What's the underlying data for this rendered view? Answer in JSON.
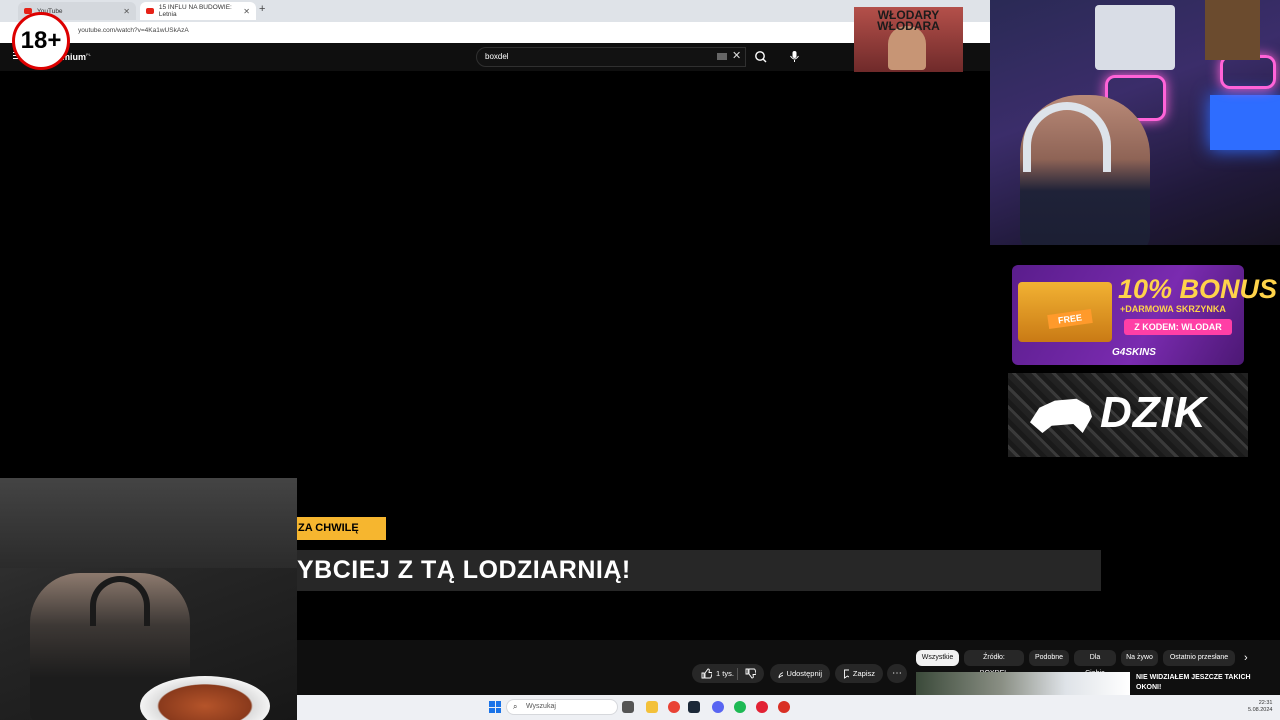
{
  "browser": {
    "tabs": [
      {
        "label": "YouTube",
        "active": false
      },
      {
        "label": "15 INFLU NA BUDOWIE: Letnia",
        "active": true
      }
    ],
    "url": "youtube.com/watch?v=4Ka1wUSkAzA"
  },
  "overlay": {
    "age_badge": "18+",
    "sticker_text": "WŁODARY WŁODARA"
  },
  "youtube": {
    "logo_text": "mium",
    "logo_region": "PL",
    "search_query": "boxdel",
    "actions": {
      "like_count": "1 tys.",
      "share_label": "Udostępnij",
      "save_label": "Zapisz"
    },
    "chips": [
      "Wszystkie",
      "Źródło: BOXDEL",
      "Podobne",
      "Dla Ciebie",
      "Na żywo",
      "Ostatnio przesłane"
    ],
    "active_chip": "Wszystkie",
    "recommended_title": "NIE WIDZIAŁEM JESZCZE TAKICH OKONI!"
  },
  "video": {
    "later_label": "ZA CHWILĘ",
    "title_text": "YBCIEJ Z TĄ LODZIARNIĄ!"
  },
  "ads": {
    "bonus_percent": "10% BONUS",
    "bonus_sub": "+DARMOWA SKRZYNKA",
    "bonus_code": "Z KODEM: WLODAR",
    "bonus_free": "FREE",
    "bonus_brand": "G4SKINS",
    "dzik_brand": "DZIK"
  },
  "taskbar": {
    "search_placeholder": "Wyszukaj",
    "time": "22:31",
    "date": "5.08.2024"
  },
  "colors": {
    "youtube_red": "#e62117",
    "accent_yellow": "#f6b62f",
    "bonus_purple": "#7a2bb0",
    "bonus_pink": "#ff3fa6"
  }
}
